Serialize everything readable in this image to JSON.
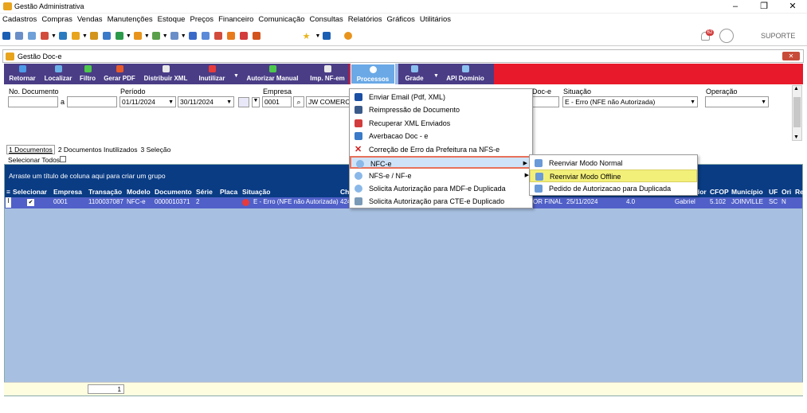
{
  "app": {
    "title": "Gestão Administrativa",
    "controls": [
      "–",
      "❐",
      "✕"
    ]
  },
  "menubar": [
    "Cadastros",
    "Compras",
    "Vendas",
    "Manutenções",
    "Estoque",
    "Preços",
    "Financeiro",
    "Comunicação",
    "Consultas",
    "Relatórios",
    "Gráficos",
    "Utilitários"
  ],
  "notifications": {
    "count": "62"
  },
  "user": {
    "label": "SUPORTE"
  },
  "window": {
    "title": "Gestão Doc-e",
    "close": "✕"
  },
  "toolbar": {
    "buttons": [
      "Retornar",
      "Localizar",
      "Filtro",
      "Gerar PDF",
      "Distribuir XML",
      "Inutilizar",
      "Autorizar Manual",
      "Imp. NF-em",
      "Processos",
      "Grade",
      "API Dominio"
    ]
  },
  "filters": {
    "doc_label": "No. Documento",
    "doc_from": "",
    "doc_sep": "a",
    "doc_to": "",
    "period_label": "Período",
    "period_from": "01/11/2024",
    "period_to": "30/11/2024",
    "company_label": "Empresa",
    "company_code": "0001",
    "company_name": "JW COMERCI",
    "type_label_tail": "Doc-e",
    "situation_label": "Situação",
    "situation_value": "E - Erro (NFE não Autorizada)",
    "operation_label": "Operação",
    "operation_value": ""
  },
  "tabs": [
    "1 Documentos",
    "2 Documentos Inutilizados",
    "3 Seleção"
  ],
  "select_all": "Selecionar Todos",
  "grid": {
    "group_hint": "Arraste um título de coluna aqui para criar um grupo",
    "columns_left": [
      "Selecionar",
      "Empresa",
      "Transação",
      "Modelo",
      "Documento",
      "Série",
      "Placa",
      "Situação",
      "Ch"
    ],
    "columns_right": [
      "dor",
      "CFOP",
      "Município",
      "UF",
      "Ori",
      "Re"
    ],
    "row": {
      "indicator": "I",
      "selected": "✔",
      "empresa": "0001",
      "transacao": "1100037087",
      "modelo": "NFC-e",
      "documento": "0000010371",
      "serie": "2",
      "placa": "",
      "situacao": "E - Erro (NFE não Autorizada)",
      "ch": "424",
      "cliente_tail": "OR FINAL",
      "data": "25/11/2024",
      "versao": "4.0",
      "vendedor": "Gabriel",
      "cfop": "5.102",
      "municipio": "JOINVILLE",
      "uf": "SC",
      "ori": "N"
    },
    "pager": "1"
  },
  "context_menu": {
    "items": [
      "Enviar Email (Pdf, XML)",
      "Reimpressão de Documento",
      "Recuperar XML Enviados",
      "Averbacao Doc - e",
      "Correção de Erro da Prefeitura na NFS-e",
      "NFC-e",
      "NFS-e / NF-e",
      "Solicita Autorização para MDF-e Duplicada",
      "Solicita Autorização para CTE-e Duplicado"
    ]
  },
  "submenu": {
    "items": [
      "Reenviar Modo Normal",
      "Reenviar Modo Offline",
      "Pedido de Autorizacao para Duplicada"
    ]
  }
}
